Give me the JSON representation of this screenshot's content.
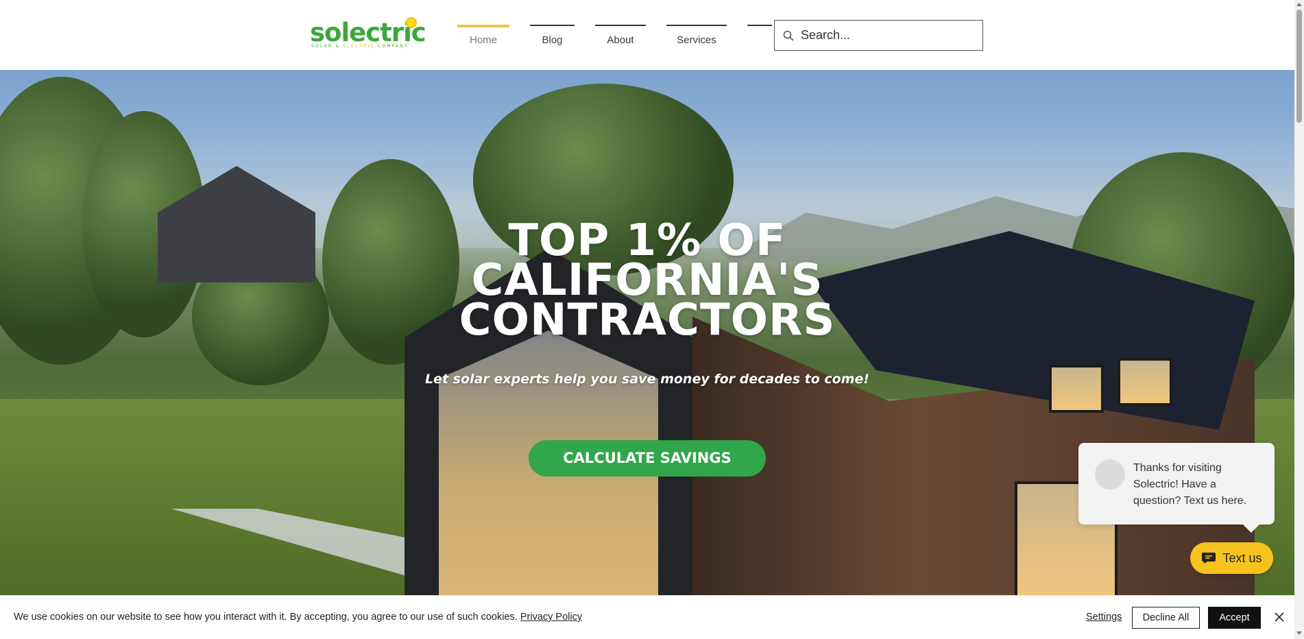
{
  "brand": {
    "logo_text": "solectric",
    "logo_tagline_a": "SOLAR & ",
    "logo_tagline_b": "ELECTRIC",
    "logo_tagline_c": " COMPANY",
    "logo_green": "#3da63c",
    "logo_yellow": "#f2b705"
  },
  "nav": {
    "items": [
      {
        "label": "Home",
        "active": true
      },
      {
        "label": "Blog",
        "active": false
      },
      {
        "label": "About",
        "active": false
      },
      {
        "label": "Services",
        "active": false
      }
    ],
    "active_color": "#f0c34b"
  },
  "search": {
    "placeholder": "Search..."
  },
  "hero": {
    "title_line1": "TOP 1% OF",
    "title_line2": "CALIFORNIA'S",
    "title_line3": "CONTRACTORS",
    "subtitle": "Let solar experts help you save money for decades to come!",
    "cta_label": "CALCULATE SAVINGS",
    "cta_color": "#31a64a"
  },
  "chat": {
    "message": "Thanks for visiting Solectric! Have a question? Text us here.",
    "button_label": "Text us",
    "button_color": "#f7c21b"
  },
  "cookie": {
    "text": "We use cookies on our website to see how you interact with it. By accepting, you agree to our use of such cookies.",
    "policy_link": "Privacy Policy",
    "settings_label": "Settings",
    "decline_label": "Decline All",
    "accept_label": "Accept"
  }
}
